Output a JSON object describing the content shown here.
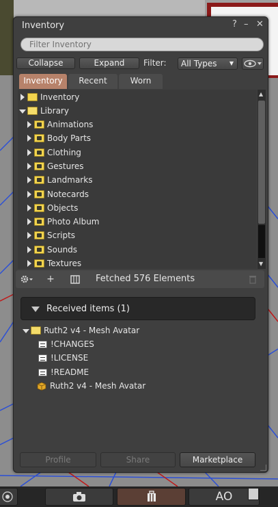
{
  "window": {
    "title": "Inventory",
    "help_glyph": "?",
    "minimize_glyph": "–",
    "close_glyph": "✕"
  },
  "search": {
    "placeholder": "Filter Inventory",
    "value": ""
  },
  "controls": {
    "collapse_label": "Collapse",
    "expand_label": "Expand",
    "filter_label": "Filter:",
    "filter_selected": "All Types"
  },
  "tabs": [
    {
      "label": "Inventory",
      "active": true
    },
    {
      "label": "Recent",
      "active": false
    },
    {
      "label": "Worn",
      "active": false
    }
  ],
  "tree": {
    "items": [
      {
        "label": "Inventory",
        "icon": "folder-icon",
        "expanded": false
      },
      {
        "label": "Library",
        "icon": "folder-open-icon",
        "expanded": true
      },
      {
        "label": "Animations",
        "icon": "folder-animations-icon"
      },
      {
        "label": "Body Parts",
        "icon": "folder-bodyparts-icon"
      },
      {
        "label": "Clothing",
        "icon": "folder-clothing-icon"
      },
      {
        "label": "Gestures",
        "icon": "folder-gestures-icon"
      },
      {
        "label": "Landmarks",
        "icon": "folder-landmarks-icon"
      },
      {
        "label": "Notecards",
        "icon": "folder-notecards-icon"
      },
      {
        "label": "Objects",
        "icon": "folder-objects-icon"
      },
      {
        "label": "Photo Album",
        "icon": "folder-photo-icon"
      },
      {
        "label": "Scripts",
        "icon": "folder-scripts-icon"
      },
      {
        "label": "Sounds",
        "icon": "folder-sounds-icon"
      },
      {
        "label": "Textures",
        "icon": "folder-textures-icon"
      }
    ]
  },
  "toolbar": {
    "gear_icon": "gear-icon",
    "add_glyph": "+",
    "status": "Fetched 576 Elements"
  },
  "received": {
    "header": "Received items (1)",
    "items": [
      {
        "label": "Ruth2 v4 - Mesh Avatar",
        "icon": "folder-open-icon"
      },
      {
        "label": "!CHANGES",
        "icon": "notecard-icon"
      },
      {
        "label": "!LICENSE",
        "icon": "notecard-icon"
      },
      {
        "label": "!README",
        "icon": "notecard-icon"
      },
      {
        "label": "Ruth2 v4 - Mesh Avatar",
        "icon": "object-box-icon"
      }
    ]
  },
  "footer": {
    "profile_label": "Profile",
    "share_label": "Share",
    "marketplace_label": "Marketplace"
  },
  "bottombar": {
    "ao_label": "AO"
  },
  "colors": {
    "active_tab": "#b7826a",
    "panel_bg": "#3f3f3f",
    "folder": "#f2d44e"
  }
}
